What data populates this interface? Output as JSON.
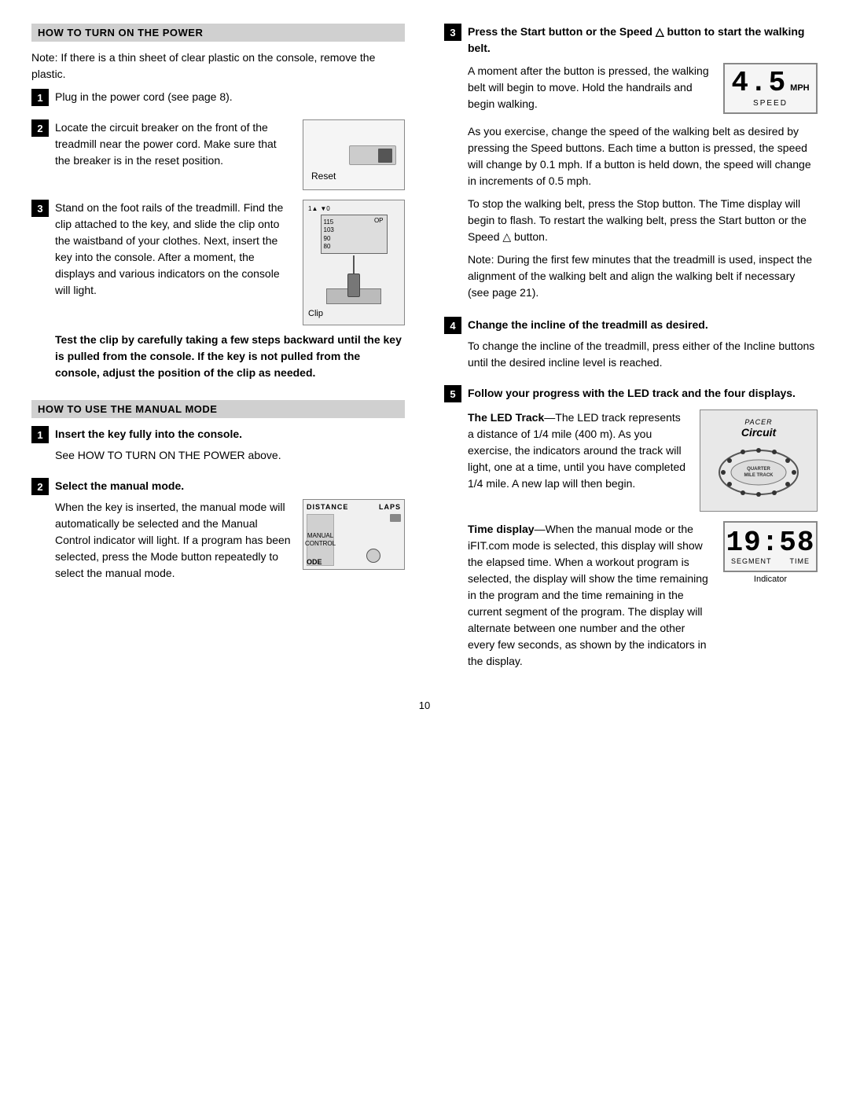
{
  "left": {
    "section1_title": "HOW TO TURN ON THE POWER",
    "note": "Note: If there is a thin sheet of clear plastic on the console, remove the plastic.",
    "step1": "Plug in the power cord (see page 8).",
    "step2_text": "Locate the circuit breaker on the front of the treadmill near the power cord. Make sure that the breaker is in the reset position.",
    "reset_label": "Reset",
    "step3_text": "Stand on the foot rails of the treadmill. Find the clip attached to the key, and slide the clip onto the waistband of your clothes. Next, insert the key into the console. After a moment, the displays and various indicators on the console will light.",
    "clip_label": "Clip",
    "step3_bold": "Test the clip by carefully taking a few steps backward until the key is pulled from the console. If the key is not pulled from the console, adjust the position of the clip as needed.",
    "section2_title": "HOW TO USE THE MANUAL MODE",
    "manual_step1_bold": "Insert the key fully into the console.",
    "manual_step1_sub": "See HOW TO TURN ON THE POWER above.",
    "manual_step2_bold": "Select the manual mode.",
    "manual_step2_text": "When the key is inserted, the manual mode will automatically be selected and the Manual Control indicator will light. If a program has been selected, press the Mode button repeatedly to select the manual mode.",
    "manual_display_top_left": "DISTANCE",
    "manual_display_top_right": "LAPS",
    "manual_control_label": "MANUAL\nCONTROL",
    "ode_label": "ODE"
  },
  "right": {
    "step3_heading": "Press the Start button or the Speed △ button to start the walking belt.",
    "step3_para1": "A moment after the button is pressed, the walking belt will begin to move. Hold the handrails and begin walking.",
    "speed_number": "4.5",
    "speed_unit": "MPH",
    "speed_label": "SPEED",
    "step3_para2": "As you exercise, change the speed of the walking belt as desired by pressing the Speed buttons. Each time a button is pressed, the speed will change by 0.1 mph. If a button is held down, the speed will change in increments of 0.5 mph.",
    "step3_para3": "To stop the walking belt, press the Stop button. The Time display will begin to flash. To restart the walking belt, press the Start button or the Speed △ button.",
    "step3_note": "Note: During the first few minutes that the treadmill is used, inspect the alignment of the walking belt and align the walking belt if necessary (see page 21).",
    "step4_heading": "Change the incline of the treadmill as desired.",
    "step4_text": "To change the incline of the treadmill, press either of the Incline buttons until the desired incline level is reached.",
    "step5_heading": "Follow your progress with the LED track and the four displays.",
    "led_track_heading": "The LED Track",
    "led_track_dash": "—",
    "led_track_text": "The LED track represents a distance of 1/4 mile (400 m). As you exercise, the indicators around the track will light, one at a time, until you have completed 1/4 mile. A new lap will then begin.",
    "pacer_text": "PACER",
    "circuit_text": "Circuit",
    "quarter_mile": "QUARTER\nMILE TRACK",
    "time_display_heading": "Time display",
    "time_display_dash": "—",
    "time_display_text": "When the manual mode or the iFIT.com mode is selected, this display will show the elapsed time. When a workout program is selected, the display will show the time remaining in the program and the time remaining in the current segment of the program. The display will alternate between one number and the other every few seconds, as shown by the indicators in the display.",
    "time_number": "19:58",
    "time_segment": "SEGMENT",
    "time_label": "TIME",
    "indicator_label": "Indicator"
  },
  "page_number": "10"
}
